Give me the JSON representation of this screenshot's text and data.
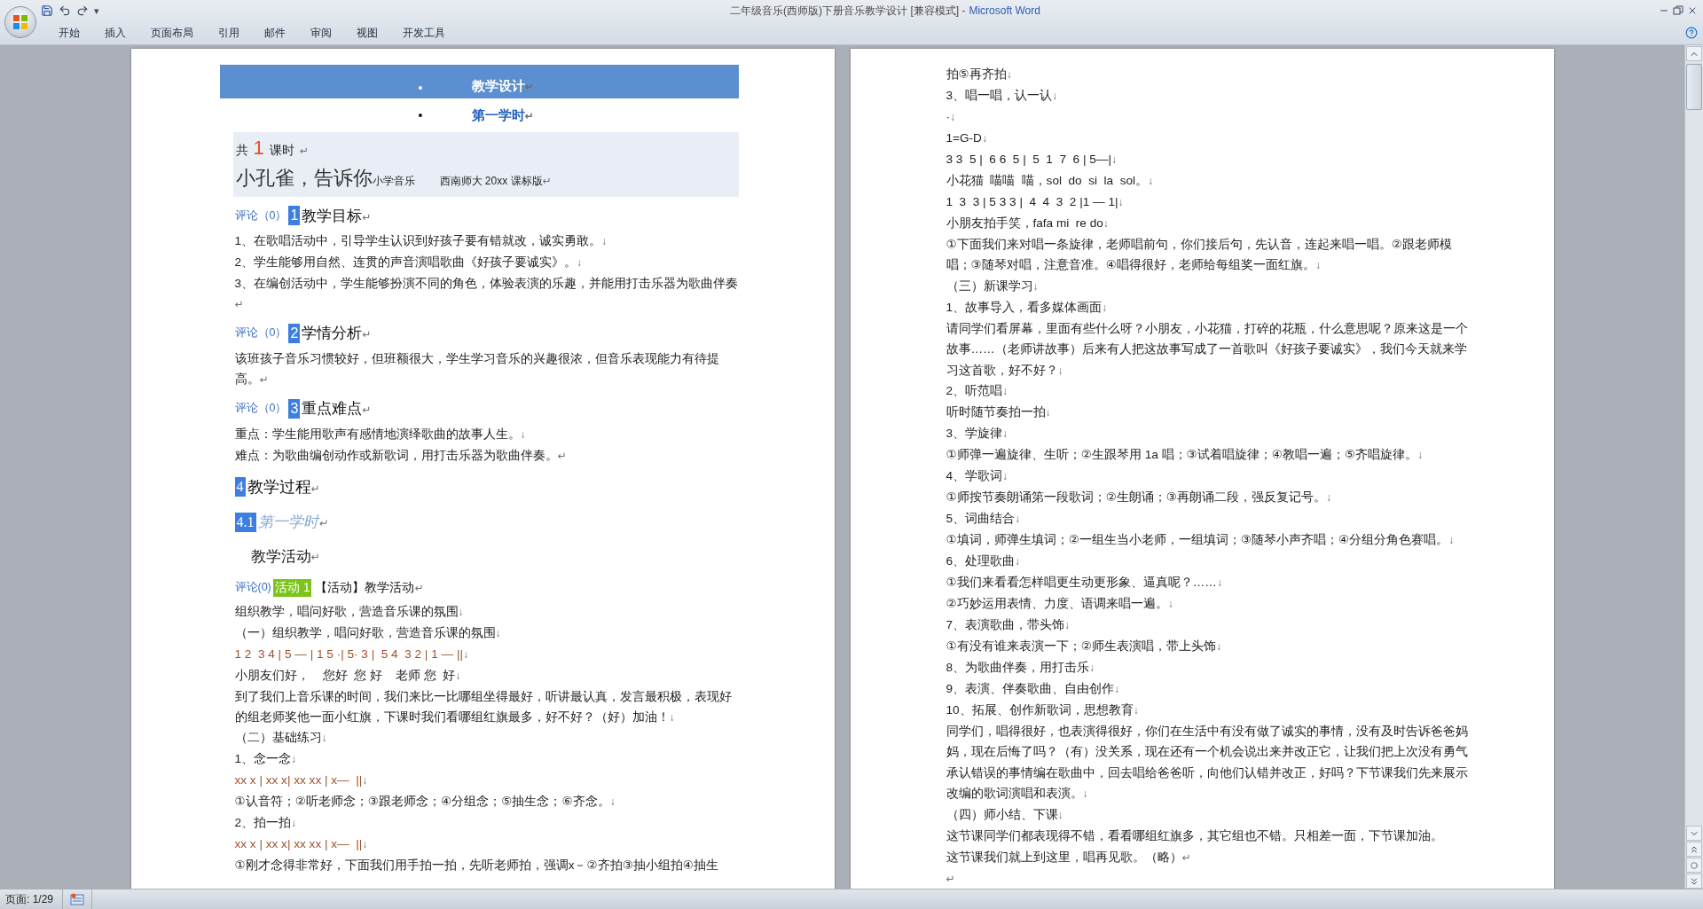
{
  "window": {
    "title": "二年级音乐(西师版)下册音乐教学设计 [兼容模式] -",
    "app": "Microsoft Word"
  },
  "quick_access": {
    "menu": "▾"
  },
  "ribbon_tabs": [
    {
      "label": "开始",
      "selected": false
    },
    {
      "label": "插入",
      "selected": false
    },
    {
      "label": "页面布局",
      "selected": false
    },
    {
      "label": "引用",
      "selected": false
    },
    {
      "label": "邮件",
      "selected": false
    },
    {
      "label": "审阅",
      "selected": false
    },
    {
      "label": "视图",
      "selected": false
    },
    {
      "label": "开发工具",
      "selected": false
    }
  ],
  "pages": [
    {
      "blocks": [
        {
          "kind": "banner",
          "bullet": "•",
          "text": "教学设计",
          "mark": "↵"
        },
        {
          "kind": "subtitle",
          "bullet": "•",
          "text": "第一学时",
          "mark": "↵"
        },
        {
          "kind": "infobox",
          "count_prefix": "共",
          "count": "1",
          "count_suffix": "课时",
          "count_mark": "↵",
          "song": "小孔雀，告诉你",
          "subject": "小学音乐",
          "edition": "西南师大 20xx 课标版",
          "mark": "↵"
        },
        {
          "kind": "heading",
          "comment": "评论（0）",
          "number": "1",
          "text": "教学目标",
          "mark": "↵"
        },
        {
          "kind": "para",
          "text": "1、在歌唱活动中，引导学生认识到好孩子要有错就改，诚实勇敢。",
          "mark": "↓"
        },
        {
          "kind": "para",
          "text": "2、学生能够用自然、连贯的声音演唱歌曲《好孩子要诚实》。",
          "mark": "↓"
        },
        {
          "kind": "para",
          "text": "3、在编创活动中，学生能够扮演不同的角色，体验表演的乐趣，并能用打击乐器为歌曲伴奏",
          "mark": "↵"
        },
        {
          "kind": "heading",
          "comment": "评论（0）",
          "number": "2",
          "text": "学情分析",
          "mark": "↵"
        },
        {
          "kind": "para",
          "text": "该班孩子音乐习惯较好，但班额很大，学生学习音乐的兴趣很浓，但音乐表现能力有待提高。",
          "mark": "↵"
        },
        {
          "kind": "heading",
          "comment": "评论（0）",
          "number": "3",
          "text": "重点难点",
          "mark": "↵"
        },
        {
          "kind": "para",
          "text": "重点：学生能用歌声有感情地演绎歌曲的故事人生。",
          "mark": "↓"
        },
        {
          "kind": "para",
          "text": "难点：为歌曲编创动作或新歌词，用打击乐器为歌曲伴奏。",
          "mark": "↵"
        },
        {
          "kind": "section",
          "number": "4",
          "text": "教学过程",
          "mark": "↵"
        },
        {
          "kind": "subsection",
          "number": "4.1",
          "text": "第一学时",
          "mark": "↵"
        },
        {
          "kind": "activity_title",
          "text": "教学活动",
          "mark": "↵"
        },
        {
          "kind": "activity",
          "comment": "评论(0)",
          "tag": "活动 1",
          "text": "【活动】教学活动",
          "mark": "↵"
        },
        {
          "kind": "para",
          "text": "组织教学，唱问好歌，营造音乐课的氛围",
          "mark": "↓"
        },
        {
          "kind": "para",
          "text": "（一）组织教学，唱问好歌，营造音乐课的氛围",
          "mark": "↓"
        },
        {
          "kind": "notation",
          "text": "1 2  3 4 | 5 — | 1 5 ·| 5· 3 |  5 4  3 2 | 1 — ||",
          "mark": "↓"
        },
        {
          "kind": "para",
          "text": "小朋友们好，    您好  您 好    老师 您  好",
          "mark": "↓"
        },
        {
          "kind": "para",
          "text": "到了我们上音乐课的时间，我们来比一比哪组坐得最好，听讲最认真，发言最积极，表现好的组老师奖他一面小红旗，下课时我们看哪组红旗最多，好不好？（好）加油！",
          "mark": "↓"
        },
        {
          "kind": "para",
          "text": "（二）基础练习",
          "mark": "↓"
        },
        {
          "kind": "para",
          "text": "1、念一念",
          "mark": "↓"
        },
        {
          "kind": "notation",
          "text": "xx x | xx x| xx xx | x—  ||",
          "mark": "↓"
        },
        {
          "kind": "para",
          "text": "①认音符；②听老师念；③跟老师念；④分组念；⑤抽生念；⑥齐念。",
          "mark": "↓"
        },
        {
          "kind": "para",
          "text": "2、拍一拍",
          "mark": "↓"
        },
        {
          "kind": "notation",
          "text": "xx x | xx x| xx xx | x—  ||",
          "mark": "↓"
        },
        {
          "kind": "para",
          "text": "①刚才念得非常好，下面我们用手拍一拍，先听老师拍，强调x－②齐拍③抽小组拍④抽生"
        }
      ]
    },
    {
      "blocks": [
        {
          "kind": "para",
          "text": "拍⑤再齐拍",
          "mark": "↓"
        },
        {
          "kind": "para",
          "text": "3、唱一唱，认一认",
          "mark": "↓"
        },
        {
          "kind": "para",
          "text": "·",
          "mark": "↓"
        },
        {
          "kind": "para",
          "text": "1=G-D",
          "mark": "↓"
        },
        {
          "kind": "para",
          "text": "3 3  5 |  6 6  5 |  5  1  7  6 | 5—|",
          "mark": "↓"
        },
        {
          "kind": "para",
          "text": "小花猫  喵喵  喵，sol  do  si  la  sol。",
          "mark": "↓"
        },
        {
          "kind": "para",
          "text": "1  3  3 | 5 3 3 |  4  4  3  2 |1 — 1|",
          "mark": "↓"
        },
        {
          "kind": "para",
          "text": "小朋友拍手笑，fafa mi  re do",
          "mark": "↓"
        },
        {
          "kind": "para",
          "text": "①下面我们来对唱一条旋律，老师唱前句，你们接后句，先认音，连起来唱一唱。②跟老师模唱；③随琴对唱，注意音准。④唱得很好，老师给每组奖一面红旗。",
          "mark": "↓"
        },
        {
          "kind": "para",
          "text": "（三）新课学习",
          "mark": "↓"
        },
        {
          "kind": "para",
          "text": "1、故事导入，看多媒体画面",
          "mark": "↓"
        },
        {
          "kind": "para",
          "text": "请同学们看屏幕，里面有些什么呀？小朋友，小花猫，打碎的花瓶，什么意思呢？原来这是一个故事……（老师讲故事）后来有人把这故事写成了一首歌叫《好孩子要诚实》，我们今天就来学习这首歌，好不好？",
          "mark": "↓"
        },
        {
          "kind": "para",
          "text": "2、听范唱",
          "mark": "↓"
        },
        {
          "kind": "para",
          "text": "听时随节奏拍一拍",
          "mark": "↓"
        },
        {
          "kind": "para",
          "text": "3、学旋律",
          "mark": "↓"
        },
        {
          "kind": "para",
          "text": "①师弹一遍旋律、生听；②生跟琴用 1a 唱；③试着唱旋律；④教唱一遍；⑤齐唱旋律。",
          "mark": "↓"
        },
        {
          "kind": "para",
          "text": "4、学歌词",
          "mark": "↓"
        },
        {
          "kind": "para",
          "text": "①师按节奏朗诵第一段歌词；②生朗诵；③再朗诵二段，强反复记号。",
          "mark": "↓"
        },
        {
          "kind": "para",
          "text": "5、词曲结合",
          "mark": "↓"
        },
        {
          "kind": "para",
          "text": "①填词，师弹生填词；②一组生当小老师，一组填词；③随琴小声齐唱；④分组分角色赛唱。",
          "mark": "↓"
        },
        {
          "kind": "para",
          "text": "6、处理歌曲",
          "mark": "↓"
        },
        {
          "kind": "para",
          "text": "①我们来看看怎样唱更生动更形象、逼真呢？……",
          "mark": "↓"
        },
        {
          "kind": "para",
          "text": "②巧妙运用表情、力度、语调来唱一遍。",
          "mark": "↓"
        },
        {
          "kind": "para",
          "text": "7、表演歌曲，带头饰",
          "mark": "↓"
        },
        {
          "kind": "para",
          "text": "①有没有谁来表演一下；②师生表演唱，带上头饰",
          "mark": "↓"
        },
        {
          "kind": "para",
          "text": "8、为歌曲伴奏，用打击乐",
          "mark": "↓"
        },
        {
          "kind": "para",
          "text": "9、表演、伴奏歌曲、自由创作",
          "mark": "↓"
        },
        {
          "kind": "para",
          "text": "10、拓展、创作新歌词，思想教育",
          "mark": "↓"
        },
        {
          "kind": "para",
          "text": "同学们，唱得很好，也表演得很好，你们在生活中有没有做了诚实的事情，没有及时告诉爸爸妈妈，现在后悔了吗？（有）没关系，现在还有一个机会说出来并改正它，让我们把上次没有勇气承认错误的事情编在歌曲中，回去唱给爸爸听，向他们认错并改正，好吗？下节课我们先来展示改编的歌词演唱和表演。",
          "mark": "↓"
        },
        {
          "kind": "para",
          "text": "（四）师小结、下课",
          "mark": "↓"
        },
        {
          "kind": "para",
          "text": "这节课同学们都表现得不错，看看哪组红旗多，其它组也不错。只相差一面，下节课加油。"
        },
        {
          "kind": "para",
          "text": "这节课我们就上到这里，唱再见歌。（略）",
          "mark": "↵"
        },
        {
          "kind": "para",
          "mark": "↵"
        }
      ]
    }
  ],
  "status_bar": {
    "page": "页面: 1/29"
  }
}
